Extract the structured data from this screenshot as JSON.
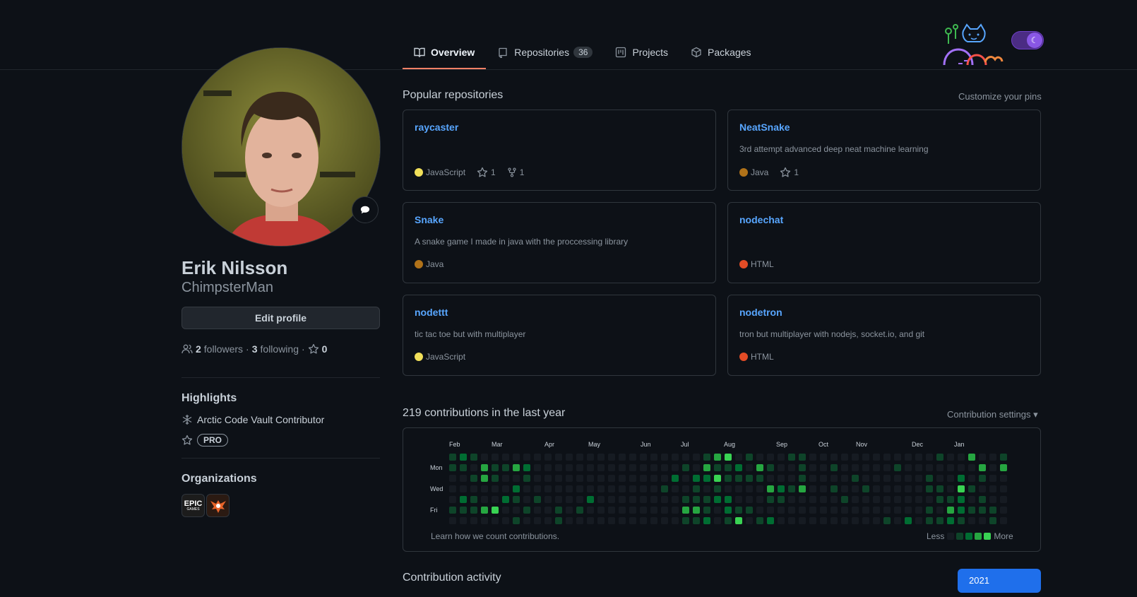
{
  "nav": {
    "tabs": [
      {
        "label": "Overview",
        "icon": "book-icon",
        "active": true
      },
      {
        "label": "Repositories",
        "icon": "repo-icon",
        "count": "36"
      },
      {
        "label": "Projects",
        "icon": "project-icon"
      },
      {
        "label": "Packages",
        "icon": "package-icon"
      }
    ]
  },
  "profile": {
    "name": "Erik Nilsson",
    "login": "ChimpsterMan",
    "edit_label": "Edit profile",
    "followers_count": "2",
    "followers_label": "followers",
    "following_count": "3",
    "following_label": "following",
    "stars_count": "0",
    "separator": "·"
  },
  "highlights": {
    "title": "Highlights",
    "arctic": "Arctic Code Vault Contributor",
    "pro": "PRO"
  },
  "organizations": {
    "title": "Organizations",
    "epic_text": "EPIC",
    "epic_sub": "GAMES"
  },
  "popular": {
    "title": "Popular repositories",
    "customize": "Customize your pins",
    "repos": [
      {
        "name": "raycaster",
        "desc": "",
        "lang": "JavaScript",
        "lang_color": "#f1e05a",
        "stars": "1",
        "forks": "1"
      },
      {
        "name": "NeatSnake",
        "desc": "3rd attempt advanced deep neat machine learning",
        "lang": "Java",
        "lang_color": "#b07219",
        "stars": "1"
      },
      {
        "name": "Snake",
        "desc": "A snake game I made in java with the proccessing library",
        "lang": "Java",
        "lang_color": "#b07219"
      },
      {
        "name": "nodechat",
        "desc": "",
        "lang": "HTML",
        "lang_color": "#e34c26"
      },
      {
        "name": "nodettt",
        "desc": "tic tac toe but with multiplayer",
        "lang": "JavaScript",
        "lang_color": "#f1e05a"
      },
      {
        "name": "nodetron",
        "desc": "tron but multiplayer with nodejs, socket.io, and git",
        "lang": "HTML",
        "lang_color": "#e34c26"
      }
    ]
  },
  "contributions": {
    "title": "219 contributions in the last year",
    "settings": "Contribution settings ▾",
    "months": [
      "Feb",
      "Mar",
      "Apr",
      "May",
      "Jun",
      "Jul",
      "Aug",
      "Sep",
      "Oct",
      "Nov",
      "Dec",
      "Jan"
    ],
    "days": [
      "Mon",
      "Wed",
      "Fri"
    ],
    "learn": "Learn how we count contributions.",
    "less": "Less",
    "more": "More",
    "level_colors": [
      "#161b22",
      "#0e4429",
      "#006d32",
      "#26a641",
      "#39d353"
    ]
  },
  "activity": {
    "title": "Contribution activity",
    "year": "2021"
  }
}
